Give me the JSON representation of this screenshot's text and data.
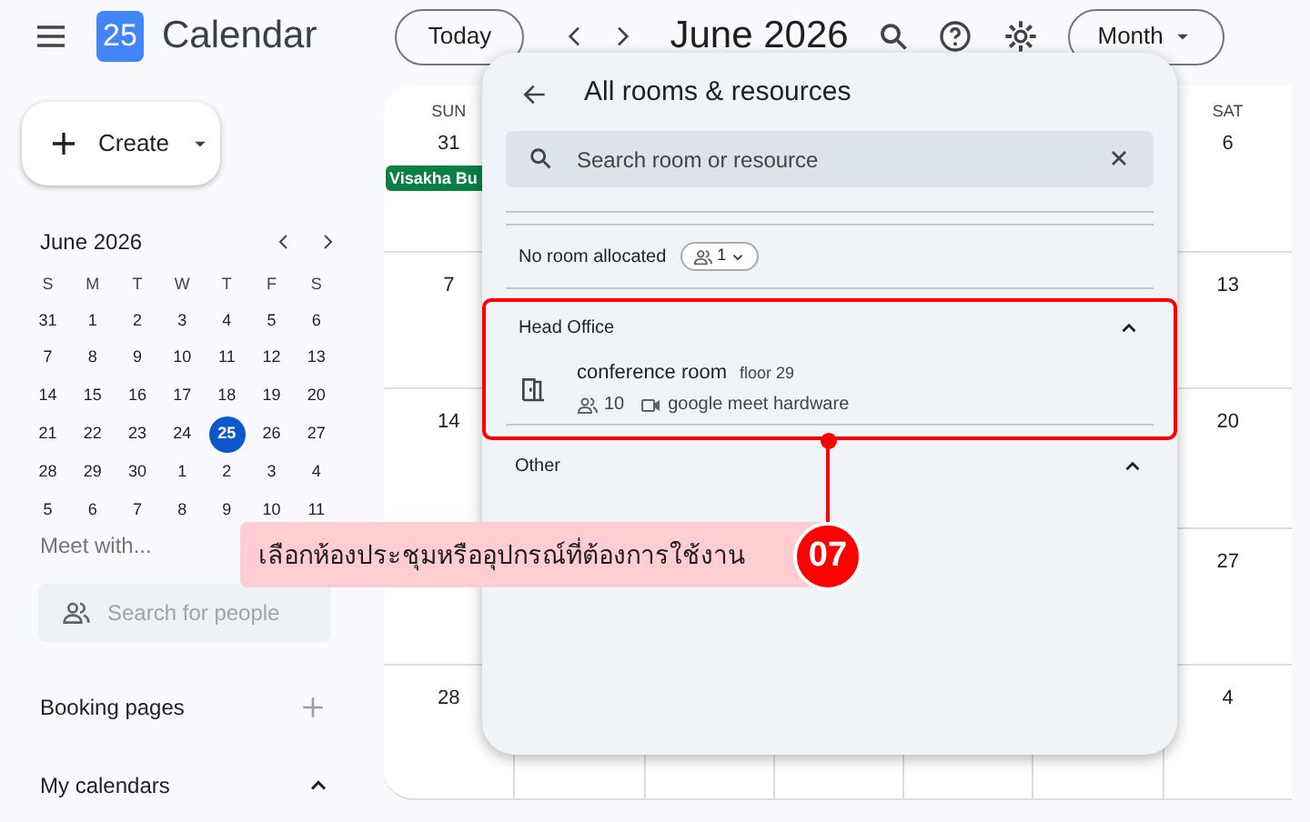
{
  "app": {
    "title": "Calendar",
    "logo_day": "25"
  },
  "toolbar": {
    "today": "Today",
    "period": "June 2026",
    "view": "Month"
  },
  "create": {
    "label": "Create"
  },
  "mini_calendar": {
    "title": "June 2026",
    "weekdays": [
      "S",
      "M",
      "T",
      "W",
      "T",
      "F",
      "S"
    ],
    "weeks": [
      [
        {
          "label": "31",
          "selected": false
        },
        {
          "label": "1",
          "selected": false
        },
        {
          "label": "2",
          "selected": false
        },
        {
          "label": "3",
          "selected": false
        },
        {
          "label": "4",
          "selected": false
        },
        {
          "label": "5",
          "selected": false
        },
        {
          "label": "6",
          "selected": false
        }
      ],
      [
        {
          "label": "7",
          "selected": false
        },
        {
          "label": "8",
          "selected": false
        },
        {
          "label": "9",
          "selected": false
        },
        {
          "label": "10",
          "selected": false
        },
        {
          "label": "11",
          "selected": false
        },
        {
          "label": "12",
          "selected": false
        },
        {
          "label": "13",
          "selected": false
        }
      ],
      [
        {
          "label": "14",
          "selected": false
        },
        {
          "label": "15",
          "selected": false
        },
        {
          "label": "16",
          "selected": false
        },
        {
          "label": "17",
          "selected": false
        },
        {
          "label": "18",
          "selected": false
        },
        {
          "label": "19",
          "selected": false
        },
        {
          "label": "20",
          "selected": false
        }
      ],
      [
        {
          "label": "21",
          "selected": false
        },
        {
          "label": "22",
          "selected": false
        },
        {
          "label": "23",
          "selected": false
        },
        {
          "label": "24",
          "selected": false
        },
        {
          "label": "25",
          "selected": true
        },
        {
          "label": "26",
          "selected": false
        },
        {
          "label": "27",
          "selected": false
        }
      ],
      [
        {
          "label": "28",
          "selected": false
        },
        {
          "label": "29",
          "selected": false
        },
        {
          "label": "30",
          "selected": false
        },
        {
          "label": "1",
          "selected": false
        },
        {
          "label": "2",
          "selected": false
        },
        {
          "label": "3",
          "selected": false
        },
        {
          "label": "4",
          "selected": false
        }
      ],
      [
        {
          "label": "5",
          "selected": false
        },
        {
          "label": "6",
          "selected": false
        },
        {
          "label": "7",
          "selected": false
        },
        {
          "label": "8",
          "selected": false
        },
        {
          "label": "9",
          "selected": false
        },
        {
          "label": "10",
          "selected": false
        },
        {
          "label": "11",
          "selected": false
        }
      ]
    ]
  },
  "sidebar": {
    "meet_with": "Meet with...",
    "people_search": {
      "placeholder": "Search for people"
    },
    "booking_pages": "Booking pages",
    "my_calendars": "My calendars"
  },
  "month_grid": {
    "rows": [
      {
        "first": {
          "weekday": "SUN",
          "date": "31",
          "event": "Visakha Bu"
        },
        "last": {
          "weekday": "SAT",
          "date": "6"
        }
      },
      {
        "first": {
          "date": "7"
        },
        "last": {
          "date": "13"
        }
      },
      {
        "first": {
          "date": "14"
        },
        "last": {
          "date": "20"
        }
      },
      {
        "last": {
          "date": "27"
        }
      },
      {
        "first": {
          "date": "28"
        },
        "last": {
          "date": "4"
        }
      }
    ]
  },
  "panel": {
    "title": "All rooms & resources",
    "search": {
      "placeholder": "Search room or resource"
    },
    "no_room": {
      "label": "No room allocated",
      "count": "1"
    },
    "groups": [
      {
        "name": "Head Office",
        "expanded": true,
        "rooms": [
          {
            "name": "conference room",
            "floor": "floor 29",
            "capacity": "10",
            "equipment": "google meet hardware"
          }
        ]
      },
      {
        "name": "Other",
        "expanded": true
      }
    ]
  },
  "callout": {
    "text": "เลือกห้องประชุมหรืออุปกรณ์ที่ต้องการใช้งาน",
    "step": "07"
  }
}
